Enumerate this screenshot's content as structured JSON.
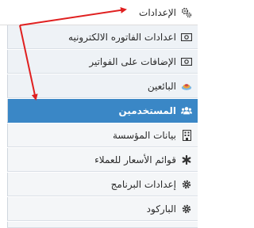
{
  "menu": {
    "settings": {
      "label": "الإعدادات",
      "icon": "gears-icon"
    },
    "items": [
      {
        "label": "اعدادات الفاتوره الالكترونيه",
        "icon": "money-icon"
      },
      {
        "label": "الإضافات على الفواتير",
        "icon": "money-icon"
      },
      {
        "label": "البائعين",
        "icon": "vendor-icon"
      },
      {
        "label": "المستخدمين",
        "icon": "users-icon",
        "active": true
      },
      {
        "label": "بيانات المؤسسة",
        "icon": "building-icon"
      },
      {
        "label": "قوائم الأسعار للعملاء",
        "icon": "asterisk-icon"
      },
      {
        "label": "إعدادات البرنامج",
        "icon": "gear-icon"
      },
      {
        "label": "الباركود",
        "icon": "gear-icon"
      }
    ]
  },
  "colors": {
    "active": "#3a87c6",
    "arrow": "#e02020"
  }
}
